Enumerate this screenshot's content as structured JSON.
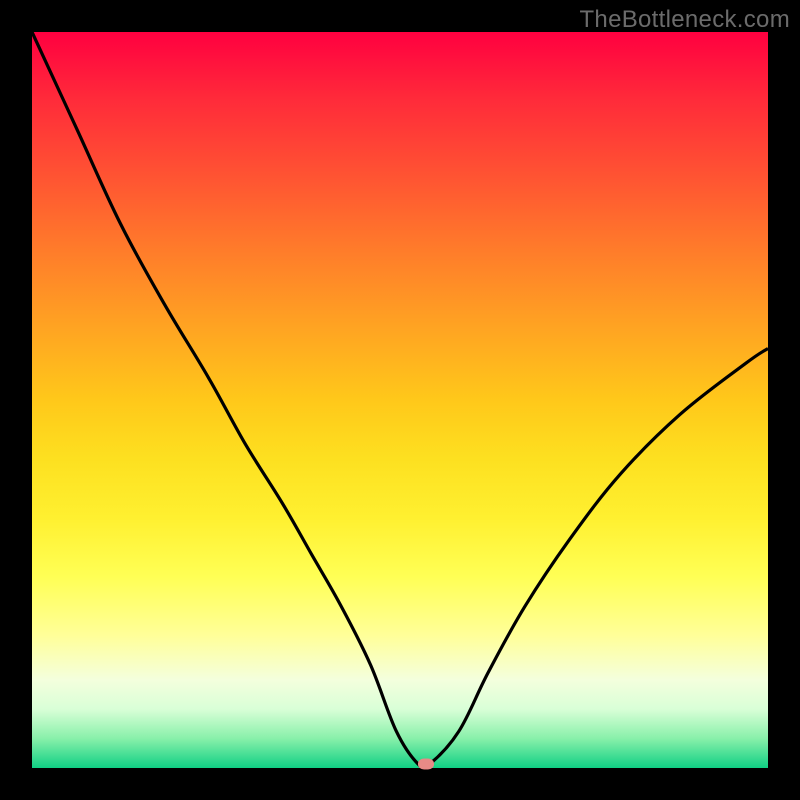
{
  "watermark": "TheBottleneck.com",
  "colors": {
    "curve_stroke": "#000000",
    "marker_fill": "#e78a86"
  },
  "chart_data": {
    "type": "line",
    "title": "",
    "xlabel": "",
    "ylabel": "",
    "xlim": [
      0,
      100
    ],
    "ylim": [
      0,
      100
    ],
    "grid": false,
    "legend": false,
    "series": [
      {
        "name": "bottleneck-curve",
        "x": [
          0,
          6,
          12,
          18,
          24,
          29,
          34,
          38,
          42,
          46,
          49.5,
          52.5,
          54,
          58,
          62,
          67,
          73,
          80,
          88,
          97,
          100
        ],
        "y": [
          100,
          87,
          74,
          63,
          53,
          44,
          36,
          29,
          22,
          14,
          5,
          0.5,
          0.5,
          5,
          13,
          22,
          31,
          40,
          48,
          55,
          57
        ]
      }
    ],
    "marker": {
      "x": 53.5,
      "y": 0.5
    },
    "background_gradient": {
      "orientation": "vertical",
      "stops": [
        {
          "pos": 0.0,
          "color": "#ff0040"
        },
        {
          "pos": 0.5,
          "color": "#ffc81a"
        },
        {
          "pos": 0.82,
          "color": "#ffff99"
        },
        {
          "pos": 1.0,
          "color": "#10d084"
        }
      ]
    }
  }
}
